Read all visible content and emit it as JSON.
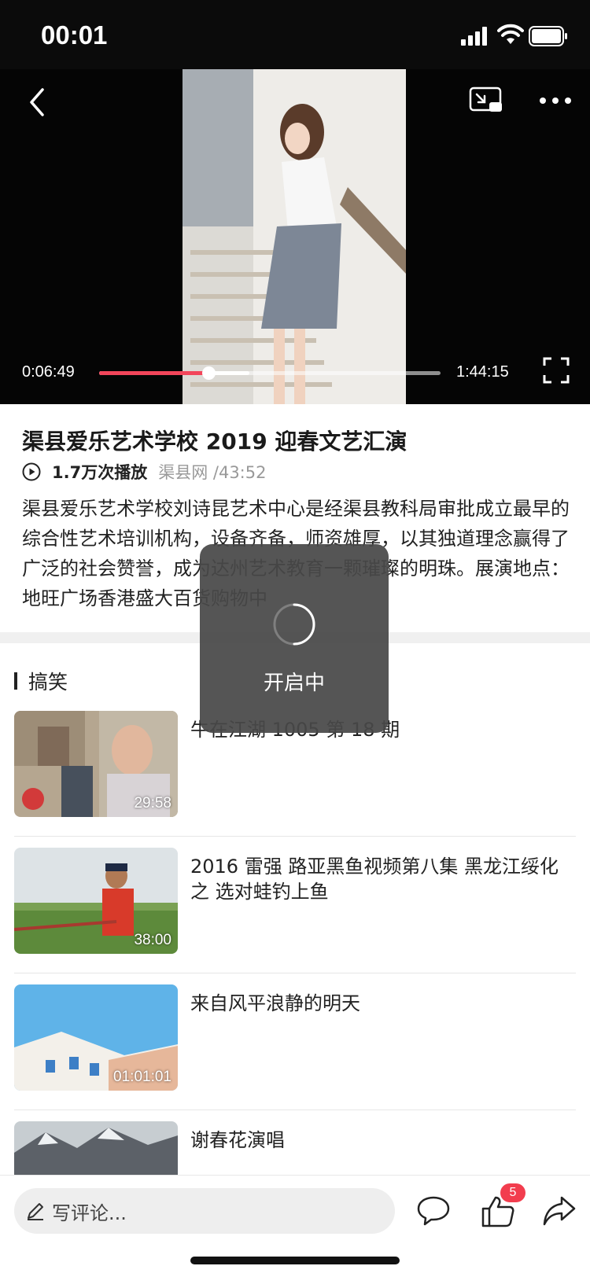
{
  "status_bar": {
    "time": "00:01"
  },
  "player": {
    "elapsed": "0:06:49",
    "duration": "1:44:15",
    "played_fraction": 0.32,
    "buffered_fraction": 0.44,
    "accent": "#f2455a"
  },
  "video": {
    "title": "渠县爱乐艺术学校 2019 迎春文艺汇演",
    "views": "1.7万次播放",
    "source": "渠县网 /43:52",
    "description": "渠县爱乐艺术学校刘诗昆艺术中心是经渠县教科局审批成立最早的综合性艺术培训机构，设备齐备，师资雄厚，以其独道理念赢得了广泛的社会赞誉，成为达州艺术教育一颗璀璨的明珠。展演地点：地旺广场香港盛大百货购物中"
  },
  "section": {
    "title": "搞笑"
  },
  "related": [
    {
      "title": "牛在江湖 1005 第 18 期",
      "duration": "29:58"
    },
    {
      "title": "2016 雷强 路亚黑鱼视频第八集 黑龙江绥化 之 选对蛙钓上鱼",
      "duration": "38:00"
    },
    {
      "title": "来自风平浪静的明天",
      "duration": "01:01:01"
    },
    {
      "title": "谢春花演唱",
      "duration": ""
    }
  ],
  "toast": {
    "text": "开启中"
  },
  "bottom_bar": {
    "comment_placeholder": "写评论...",
    "like_count": "5"
  },
  "icons": {
    "back": "chevron-left-icon",
    "pip": "picture-in-picture-icon",
    "more": "more-dots-icon",
    "fullscreen": "fullscreen-icon",
    "play": "play-circle-icon",
    "pen": "pen-icon",
    "comment": "comment-bubble-icon",
    "like": "thumbs-up-icon",
    "share": "share-arrow-icon"
  }
}
